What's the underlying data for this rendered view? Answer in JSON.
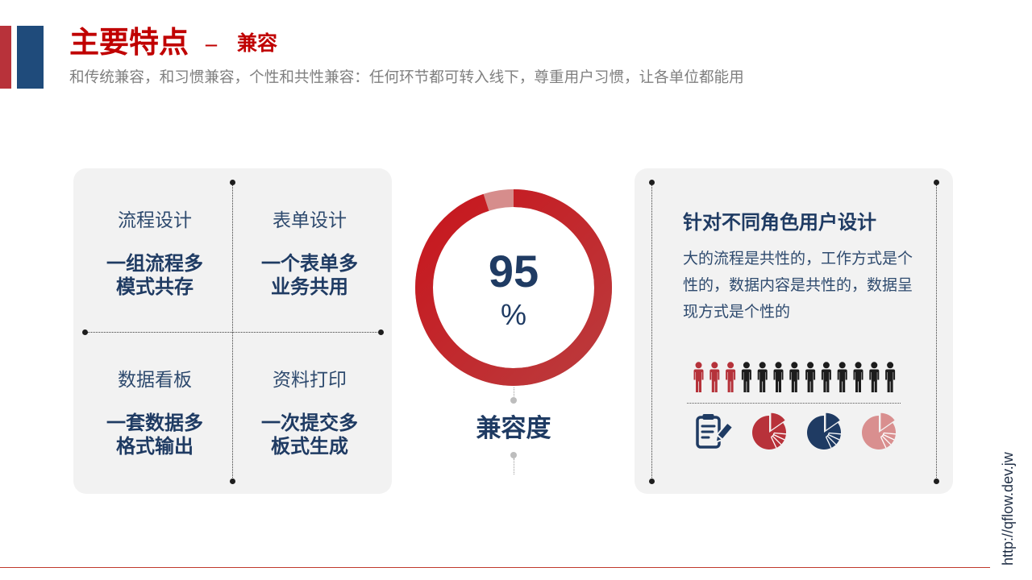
{
  "header": {
    "title": "主要特点",
    "separator": "–",
    "topic": "兼容",
    "subtitle": "和传统兼容，和习惯兼容，个性和共性兼容：任何环节都可转入线下，尊重用户习惯，让各单位都能用"
  },
  "features": [
    {
      "heading": "流程设计",
      "lines": [
        "一组流程多",
        "模式共存"
      ]
    },
    {
      "heading": "表单设计",
      "lines": [
        "一个表单多",
        "业务共用"
      ]
    },
    {
      "heading": "数据看板",
      "lines": [
        "一套数据多",
        "格式输出"
      ]
    },
    {
      "heading": "资料打印",
      "lines": [
        "一次提交多",
        "板式生成"
      ]
    }
  ],
  "compatibility": {
    "percent": 95,
    "unit": "%",
    "label": "兼容度"
  },
  "roles": {
    "heading": "针对不同角色用户设计",
    "description": "大的流程是共性的，工作方式是个性的，数据内容是共性的，数据呈现方式是个性的",
    "people": {
      "total": 13,
      "highlighted": 3
    },
    "icons": [
      {
        "name": "document-pen-icon",
        "color": "#1f3b63"
      },
      {
        "name": "pie-chart-icon",
        "color": "#b8323a"
      },
      {
        "name": "pie-chart-icon",
        "color": "#1f3b63"
      },
      {
        "name": "pie-chart-icon",
        "color": "#d98f8f"
      }
    ]
  },
  "footer": {
    "url": "http://qflow.dev.jw"
  },
  "colors": {
    "accent_red": "#b8323a",
    "accent_blue": "#1f4b7b",
    "title_red": "#c00000",
    "subtitle": "#7f7f7f",
    "panel": "#f2f2f2",
    "navy": "#1f3b63",
    "navy_light": "#2e4a6e",
    "donut_start": "#c8161d",
    "donut_end": "#bb3b3d",
    "donut_rest": "#d68d8c",
    "connector": "#bdbdbd",
    "person": "#1c1c1c",
    "person_highlight": "#b5323a",
    "line_red": "#c0392b",
    "url": "#1e2d44"
  }
}
